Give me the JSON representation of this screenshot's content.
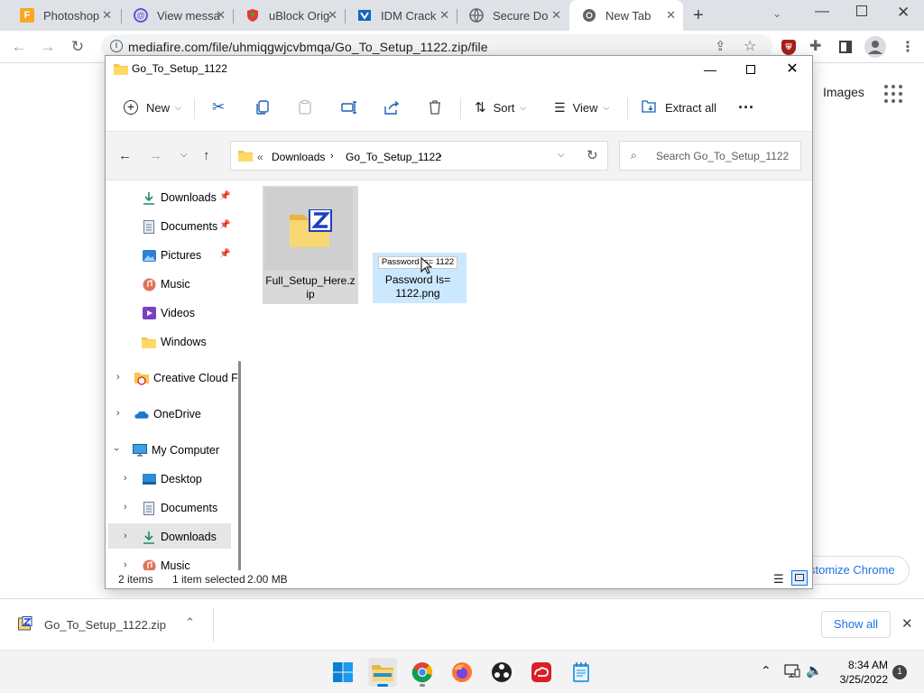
{
  "browser": {
    "tabs": [
      {
        "label": "Photoshop",
        "icon": "photoshop-icon",
        "active": false
      },
      {
        "label": "View messa",
        "icon": "messages-icon",
        "active": false
      },
      {
        "label": "uBlock Orig",
        "icon": "ublock-icon",
        "active": false
      },
      {
        "label": "IDM Crack",
        "icon": "idm-icon",
        "active": false
      },
      {
        "label": "Secure Do",
        "icon": "globe-icon",
        "active": false
      },
      {
        "label": "New Tab",
        "icon": "chrome-icon",
        "active": true
      }
    ],
    "url": "mediafire.com/file/uhmiqgwjcvbmqa/Go_To_Setup_1122.zip/file"
  },
  "google_page": {
    "images_link": "Images",
    "customize_label": "stomize Chrome"
  },
  "explorer": {
    "title": "Go_To_Setup_1122",
    "commands": {
      "new_label": "New",
      "sort_label": "Sort",
      "view_label": "View",
      "extract_label": "Extract all"
    },
    "breadcrumbs": [
      "Downloads",
      "Go_To_Setup_1122"
    ],
    "search_placeholder": "Search Go_To_Setup_1122",
    "nav": {
      "quick": [
        {
          "label": "Downloads",
          "pinned": true
        },
        {
          "label": "Documents",
          "pinned": true
        },
        {
          "label": "Pictures",
          "pinned": true
        },
        {
          "label": "Music",
          "pinned": false
        },
        {
          "label": "Videos",
          "pinned": false
        },
        {
          "label": "Windows",
          "pinned": false
        }
      ],
      "creative_cloud": "Creative Cloud F",
      "onedrive": "OneDrive",
      "my_computer": "My Computer",
      "computer_children": [
        "Desktop",
        "Documents",
        "Downloads",
        "Music"
      ],
      "selected": "Downloads"
    },
    "files": [
      {
        "name": "Full_Setup_Here.zip",
        "name_line1": "Full_Setup_Here.z",
        "name_line2": "ip",
        "type": "zip",
        "selected": true
      },
      {
        "name": "Password Is= 1122.png",
        "name_line1": "Password Is=",
        "name_line2": "1122.png",
        "type": "png",
        "selected": true,
        "thumbnail_text": "Password Is= 1122"
      }
    ],
    "status": {
      "count": "2 items",
      "selection": "1 item selected",
      "size": "2.00 MB"
    }
  },
  "download_bar": {
    "filename": "Go_To_Setup_1122.zip",
    "show_all_label": "Show all"
  },
  "taskbar": {
    "time": "8:34 AM",
    "date": "3/25/2022",
    "notification_count": "1"
  },
  "colors": {
    "chrome_tabstrip": "#dee1e6",
    "accent_blue": "#1a73e8",
    "explorer_selection": "#cce8ff",
    "folder_yellow": "#f5c84c"
  }
}
